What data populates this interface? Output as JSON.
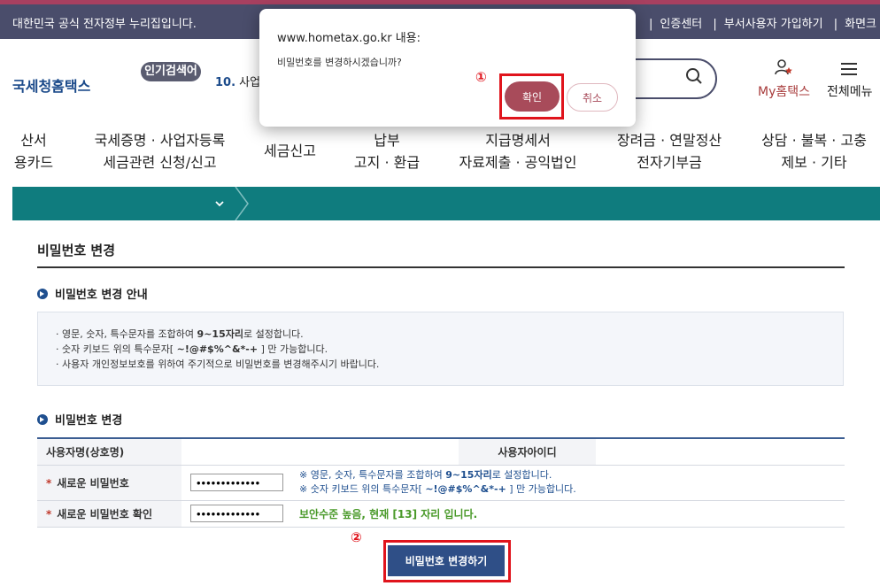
{
  "topbar": {
    "gov_notice": "대한민국 공식 전자정부 누리집입니다.",
    "links": [
      "인증센터",
      "부서사용자 가입하기",
      "화면크"
    ]
  },
  "header": {
    "logo_text": "국세청홈택스",
    "popular_badge": "인기검색어",
    "popular_rank": "10.",
    "popular_term": "사업",
    "my_label": "My홈택스",
    "menu_label": "전체메뉴"
  },
  "nav": {
    "items": [
      {
        "line1": "산서",
        "line2": "용카드"
      },
      {
        "line1": "국세증명 · 사업자등록",
        "line2": "세금관련 신청/신고"
      },
      {
        "line1": "세금신고",
        "line2": ""
      },
      {
        "line1": "납부",
        "line2": "고지 · 환급"
      },
      {
        "line1": "지급명세서",
        "line2": "자료제출 · 공익법인"
      },
      {
        "line1": "장려금 · 연말정산",
        "line2": "전자기부금"
      },
      {
        "line1": "상담 · 불복 · 고충",
        "line2": "제보 · 기타"
      }
    ]
  },
  "page": {
    "title": "비밀번호 변경",
    "guide_section_title": "비밀번호 변경 안내",
    "guide_1_pre": "영문, 숫자, 특수문자를 조합하여 ",
    "guide_1_bold": "9~15자리",
    "guide_1_post": "로 설정합니다.",
    "guide_2_pre": "숫자 키보드 위의 특수문자[ ",
    "guide_2_bold": "~!@#$%^&*-+",
    "guide_2_post": " ] 만 가능합니다.",
    "guide_3": "사용자 개인정보보호를 위하여 주기적으로 비밀번호를 변경해주시기 바랍니다.",
    "form_section_title": "비밀번호 변경"
  },
  "form": {
    "user_name_label": "사용자명(상호명)",
    "user_name_value": "",
    "user_id_label": "사용자아이디",
    "user_id_value": "",
    "required_mark": "*",
    "new_pw_label": "새로운 비밀번호",
    "new_pw_value": "•••••••••••••",
    "note_1_pre": "※ 영문, 숫자, 특수문자를 조합하여 ",
    "note_1_bold": "9~15자리",
    "note_1_post": "로 설정합니다.",
    "note_2_pre": "※ 숫자 키보드 위의 특수문자[ ",
    "note_2_bold": "~!@#$%^&*-+",
    "note_2_post": " ] 만 가능합니다.",
    "confirm_pw_label": "새로운 비밀번호 확인",
    "confirm_pw_value": "•••••••••••••",
    "strength_text": "보안수준 높음, 현재 [13] 자리 입니다.",
    "submit_label": "비밀번호 변경하기"
  },
  "annotations": {
    "marker_1": "①",
    "marker_2": "②",
    "highlight_color": "#e0141c"
  },
  "dialog": {
    "title": "www.hometax.go.kr 내용:",
    "message": "비밀번호를 변경하시겠습니까?",
    "ok_label": "확인",
    "cancel_label": "취소"
  },
  "colors": {
    "topbar": "#4a4d6b",
    "accent_bar": "#0f7c7e",
    "primary_button": "#2f4f87",
    "dialog_ok": "#a84b5a"
  }
}
